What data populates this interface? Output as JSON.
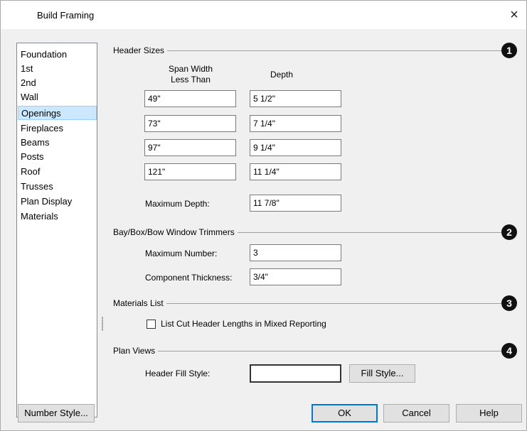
{
  "window": {
    "title": "Build Framing",
    "close_glyph": "×"
  },
  "nav": {
    "items": [
      "Foundation",
      "1st",
      "2nd",
      "Wall",
      "Openings",
      "Fireplaces",
      "Beams",
      "Posts",
      "Roof",
      "Trusses",
      "Plan Display",
      "Materials"
    ],
    "selected": "Openings"
  },
  "header_sizes": {
    "label": "Header Sizes",
    "badge": "1",
    "col_span_line1": "Span Width",
    "col_span_line2": "Less Than",
    "col_depth": "Depth",
    "rows": [
      {
        "span": "49\"",
        "depth": "5 1/2\""
      },
      {
        "span": "73\"",
        "depth": "7 1/4\""
      },
      {
        "span": "97\"",
        "depth": "9 1/4\""
      },
      {
        "span": "121\"",
        "depth": "11 1/4\""
      }
    ],
    "max_depth_label": "Maximum Depth:",
    "max_depth_value": "11 7/8\""
  },
  "trimmers": {
    "label": "Bay/Box/Bow Window Trimmers",
    "badge": "2",
    "max_number_label": "Maximum Number:",
    "max_number_value": "3",
    "thickness_label": "Component Thickness:",
    "thickness_value": "3/4\""
  },
  "materials_list": {
    "label": "Materials List",
    "badge": "3",
    "checkbox_label": "List Cut Header Lengths in Mixed Reporting",
    "checked": false
  },
  "plan_views": {
    "label": "Plan Views",
    "badge": "4",
    "fill_label": "Header Fill Style:",
    "fill_button": "Fill Style..."
  },
  "footer": {
    "number_style": "Number Style...",
    "ok": "OK",
    "cancel": "Cancel",
    "help": "Help"
  }
}
